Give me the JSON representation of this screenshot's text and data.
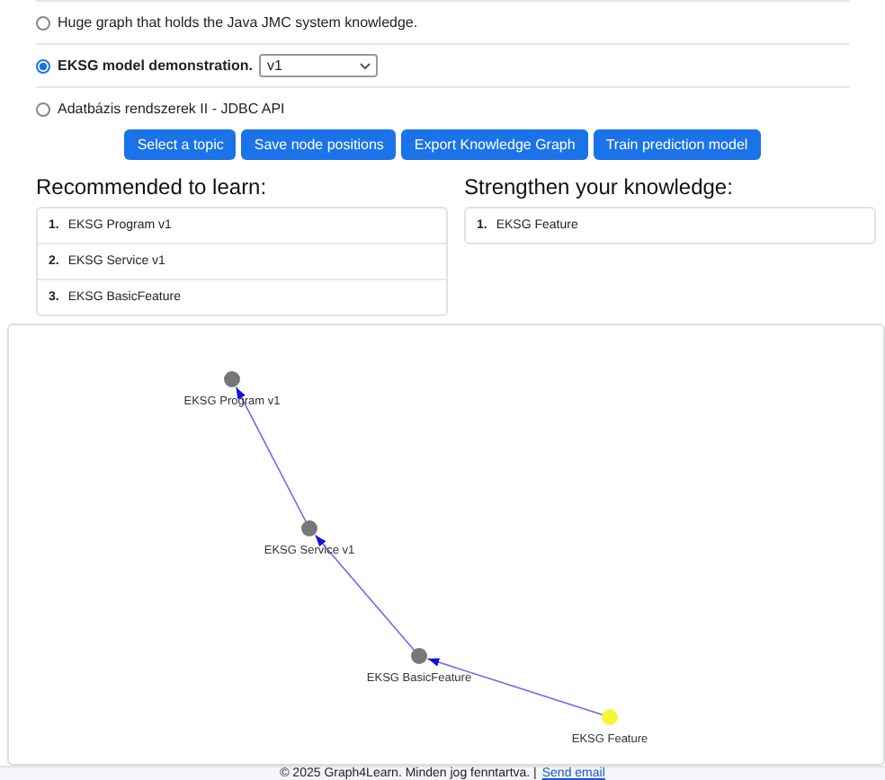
{
  "topics": [
    {
      "label": "Huge graph that holds the Java JMC system knowledge.",
      "selected": false
    },
    {
      "label": "EKSG model demonstration.",
      "selected": true,
      "version": "v1"
    },
    {
      "label": "Adatbázis rendszerek II - JDBC API",
      "selected": false
    }
  ],
  "buttons": [
    "Select a topic",
    "Save node positions",
    "Export Knowledge Graph",
    "Train prediction model"
  ],
  "recommended": {
    "title": "Recommended to learn:",
    "items": [
      {
        "number": "1.",
        "label": "EKSG Program v1"
      },
      {
        "number": "2.",
        "label": "EKSG Service v1"
      },
      {
        "number": "3.",
        "label": "EKSG BasicFeature"
      }
    ]
  },
  "strengthen": {
    "title": "Strengthen your knowledge:",
    "items": [
      {
        "number": "1.",
        "label": "EKSG Feature"
      }
    ]
  },
  "graph": {
    "nodes": [
      {
        "label": "EKSG Program v1",
        "color": "#777777",
        "children": [
          {
            "label": "EKSG Service v1",
            "color": "#777777",
            "children": [
              {
                "label": "EKSG BasicFeature",
                "color": "#777777",
                "children": [
                  {
                    "label": "EKSG Feature",
                    "color": "#f5f53a"
                  }
                ]
              }
            ]
          }
        ]
      }
    ]
  },
  "footer": {
    "text": "© 2025 Graph4Learn. Minden jog fenntartva. |",
    "link": "Send email"
  }
}
